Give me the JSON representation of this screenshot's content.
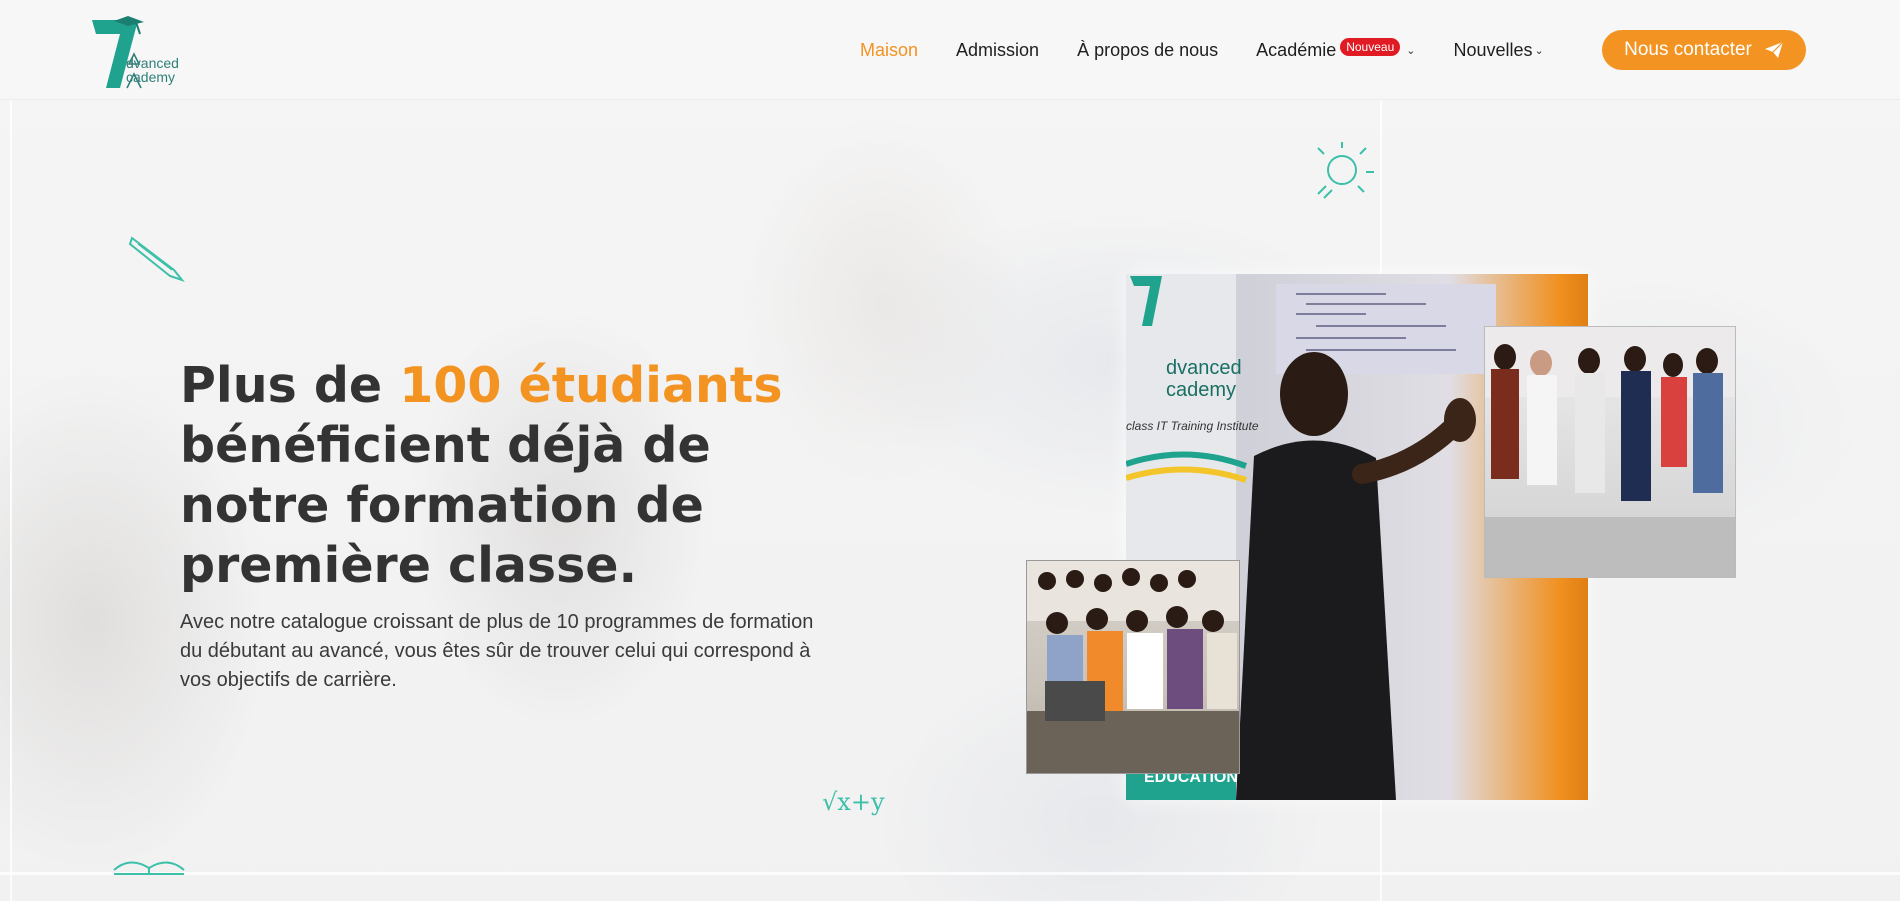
{
  "brand": {
    "logo_line1": "dvanced",
    "logo_line2": "cademy",
    "teal": "#1fa38f",
    "accent": "#f39321"
  },
  "nav": {
    "items": [
      {
        "label": "Maison",
        "active": true
      },
      {
        "label": "Admission"
      },
      {
        "label": "À propos de nous"
      },
      {
        "label": "Académie",
        "badge": "Nouveau",
        "has_dropdown": true
      },
      {
        "label": "Nouvelles",
        "has_dropdown": true
      }
    ],
    "contact_label": "Nous contacter",
    "contact_icon": "paper-plane-icon"
  },
  "hero": {
    "title_pre": "Plus de ",
    "title_accent": "100 étudiants",
    "title_post": " bénéficient déjà de notre formation de première classe.",
    "description": "Avec notre catalogue croissant de plus de 10 programmes de formation du débutant au avancé, vous êtes sûr de trouver celui qui correspond à vos objectifs de carrière."
  },
  "photos": {
    "main_banner_line1": "dvanced",
    "main_banner_line2": "cademy",
    "main_banner_tagline": "class IT Training Institute",
    "main_banner_bottom": "EDUCATION"
  },
  "doodles": {
    "math_text": "√x+y"
  }
}
